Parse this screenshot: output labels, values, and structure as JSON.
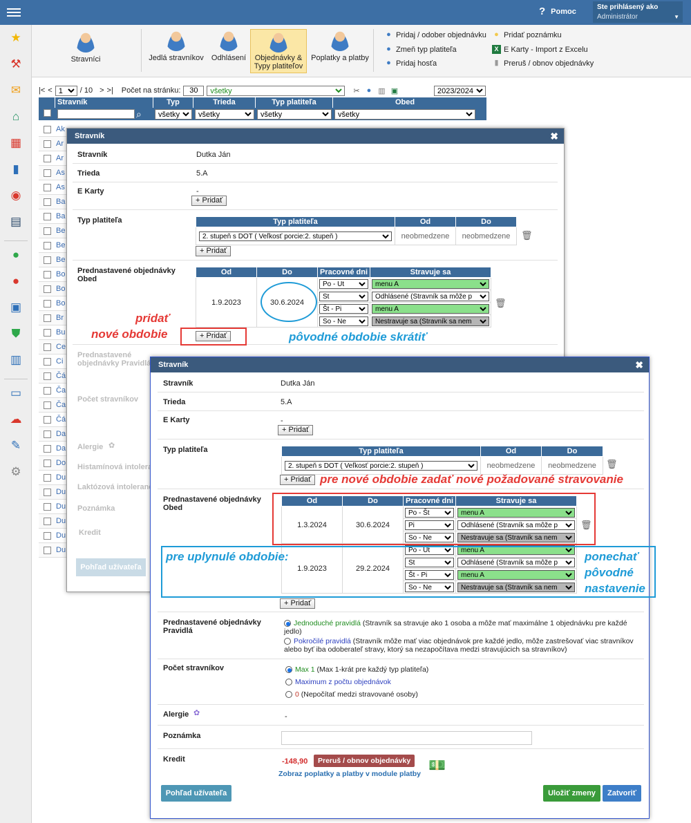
{
  "topbar": {
    "help_label": "Pomoc",
    "logged_label": "Ste prihlásený ako",
    "logged_role": "Administrátor"
  },
  "sidebar": {
    "icons": [
      "star-icon",
      "magic-wand-icon",
      "mail-icon",
      "home-icon",
      "calendar-grid-icon",
      "book-icon",
      "user-circle-icon",
      "calendar-icon",
      "check-circle-icon",
      "cancel-circle-icon",
      "briefcase-icon",
      "shield-check-icon",
      "bar-chart-icon",
      "open-book-icon",
      "chat-icon",
      "feather-icon",
      "gear-icon"
    ]
  },
  "ribbon": {
    "buttons": [
      {
        "label": "Stravníci"
      },
      {
        "label": "Jedlá stravníkov"
      },
      {
        "label": "Odhlásení"
      },
      {
        "label": "Objednávky & Typy platiteľov"
      },
      {
        "label": "Poplatky a platby"
      }
    ],
    "links": [
      {
        "label": "Pridaj / odober objednávku"
      },
      {
        "label": "Zmeň typ platiteľa"
      },
      {
        "label": "Pridaj hosťa"
      },
      {
        "label": "Pridať poznámku"
      },
      {
        "label": "E Karty - Import z Excelu"
      },
      {
        "label": "Preruš / obnov objednávky"
      }
    ]
  },
  "toolbar": {
    "first": "|<",
    "prev": "<",
    "page": "1",
    "of_pages": "/ 10",
    "next": ">",
    "last": ">|",
    "per_page_label": "Počet na stránku:",
    "per_page_value": "30",
    "filter_value": "všetky",
    "year": "2023/2024"
  },
  "grid": {
    "headers": [
      "Stravník",
      "Typ",
      "Trieda",
      "Typ platiteľa",
      "Obed"
    ],
    "filter_all": "všetky",
    "rows": [
      "Ak",
      "Ar",
      "Ar",
      "As",
      "As",
      "Ba",
      "Ba",
      "Be",
      "Be",
      "Be",
      "Bo",
      "Bo",
      "Bo",
      "Br",
      "Bu",
      "Ce",
      "Ci",
      "Čá",
      "Ča",
      "Ča",
      "Čá",
      "Da",
      "Da",
      "Do",
      "Du",
      "Du",
      "Du",
      "Du",
      "Du",
      "Du"
    ]
  },
  "dialog1": {
    "title": "Stravník",
    "stravnik_label": "Stravník",
    "stravnik_value": "Dutka Ján",
    "trieda_label": "Trieda",
    "trieda_value": "5.A",
    "ekarty_label": "E Karty",
    "ekarty_value": "-",
    "add_label": "+ Pridať",
    "typ_label": "Typ platiteľa",
    "typ_table": {
      "headers": [
        "Typ platiteľa",
        "Od",
        "Do"
      ],
      "row": {
        "typ": "2. stupeň  s DOT ( Veľkosť porcie:2. stupeň )",
        "od": "neobmedzene",
        "do": "neobmedzene"
      }
    },
    "obj_label": "Prednastavené objednávky Obed",
    "obj_table": {
      "headers": [
        "Od",
        "Do",
        "Pracovné dni",
        "Stravuje sa"
      ],
      "period": {
        "od": "1.9.2023",
        "do": "30.6.2024"
      },
      "rows": [
        {
          "days": "Po - Ut",
          "meal": "menu A"
        },
        {
          "days": "St",
          "meal": "Odhlásené (Stravník sa môže p"
        },
        {
          "days": "Št - Pi",
          "meal": "menu A"
        },
        {
          "days": "So - Ne",
          "meal": "Nestravuje sa (Stravník sa nem"
        }
      ]
    },
    "faded": {
      "pravidla": "Prednastavené objednávky Pravidlá",
      "pocet": "Počet stravníkov",
      "alergie": "Alergie",
      "histamin": "Histamínová intolerancia",
      "laktoza": "Laktózová intolerancia",
      "poznamka": "Poznámka",
      "kredit": "Kredit",
      "pohlad": "Pohľad užívateľa"
    }
  },
  "annotations": {
    "pridat_line1": "pridať",
    "pridat_line2": "nové obdobie",
    "skratit": "pôvodné obdobie skrátiť",
    "nove_stravovanie": "pre nové obdobie zadať nové požadované stravovanie",
    "uplynule": "pre uplynulé obdobie:",
    "ponechat1": "ponechať",
    "ponechat2": "pôvodné",
    "ponechat3": "nastavenie"
  },
  "dialog2": {
    "title": "Stravník",
    "stravnik_label": "Stravník",
    "stravnik_value": "Dutka Ján",
    "trieda_label": "Trieda",
    "trieda_value": "5.A",
    "ekarty_label": "E Karty",
    "ekarty_value": "-",
    "add_label": "+ Pridať",
    "typ_label": "Typ platiteľa",
    "typ_table": {
      "headers": [
        "Typ platiteľa",
        "Od",
        "Do"
      ],
      "row": {
        "typ": "2. stupeň  s DOT ( Veľkosť porcie:2. stupeň )",
        "od": "neobmedzene",
        "do": "neobmedzene"
      }
    },
    "obj_label": "Prednastavené objednávky Obed",
    "obj_table": {
      "headers": [
        "Od",
        "Do",
        "Pracovné dni",
        "Stravuje sa"
      ],
      "period1": {
        "od": "1.3.2024",
        "do": "30.6.2024"
      },
      "rows1": [
        {
          "days": "Po - Št",
          "meal": "menu A"
        },
        {
          "days": "Pi",
          "meal": "Odhlásené (Stravník sa môže p"
        },
        {
          "days": "So - Ne",
          "meal": "Nestravuje sa (Stravník sa nem"
        }
      ],
      "period2": {
        "od": "1.9.2023",
        "do": "29.2.2024"
      },
      "rows2": [
        {
          "days": "Po - Ut",
          "meal": "menu A"
        },
        {
          "days": "St",
          "meal": "Odhlásené (Stravník sa môže p"
        },
        {
          "days": "Št - Pi",
          "meal": "menu A"
        },
        {
          "days": "So - Ne",
          "meal": "Nestravuje sa (Stravník sa nem"
        }
      ]
    },
    "pravidla_label": "Prednastavené objednávky Pravidlá",
    "pravidla": {
      "opt1_name": "Jednoduché pravidlá",
      "opt1_text": " (Stravník sa stravuje ako 1 osoba a môže mať maximálne 1 objednávku pre každé jedlo)",
      "opt2_name": "Pokročilé pravidlá",
      "opt2_text": " (Stravník môže mať viac objednávok pre každé jedlo, môže zastrešovať viac stravníkov alebo byť iba odoberateľ stravy, ktorý sa nezapočítava medzi stravujúcich sa stravníkov)"
    },
    "pocet_label": "Počet stravníkov",
    "pocet": {
      "opt1_name": "Max 1",
      "opt1_text": " (Max 1-krát pre každý typ platiteľa)",
      "opt2_name": "Maximum z počtu objednávok",
      "opt3_name": "0",
      "opt3_text": " (Nepočítať medzi stravované osoby)"
    },
    "alergie_label": "Alergie",
    "alergie_value": "-",
    "poznamka_label": "Poznámka",
    "poznamka_value": "",
    "kredit_label": "Kredit",
    "kredit_value": "-148,90",
    "prerus_label": "Preruš / obnov objednávky",
    "zobraz_label": "Zobraz poplatky a platby v module platby",
    "pohlad_label": "Pohľad užívateľa",
    "ulozit_label": "Uložiť zmeny",
    "zatvorit_label": "Zatvoriť"
  }
}
